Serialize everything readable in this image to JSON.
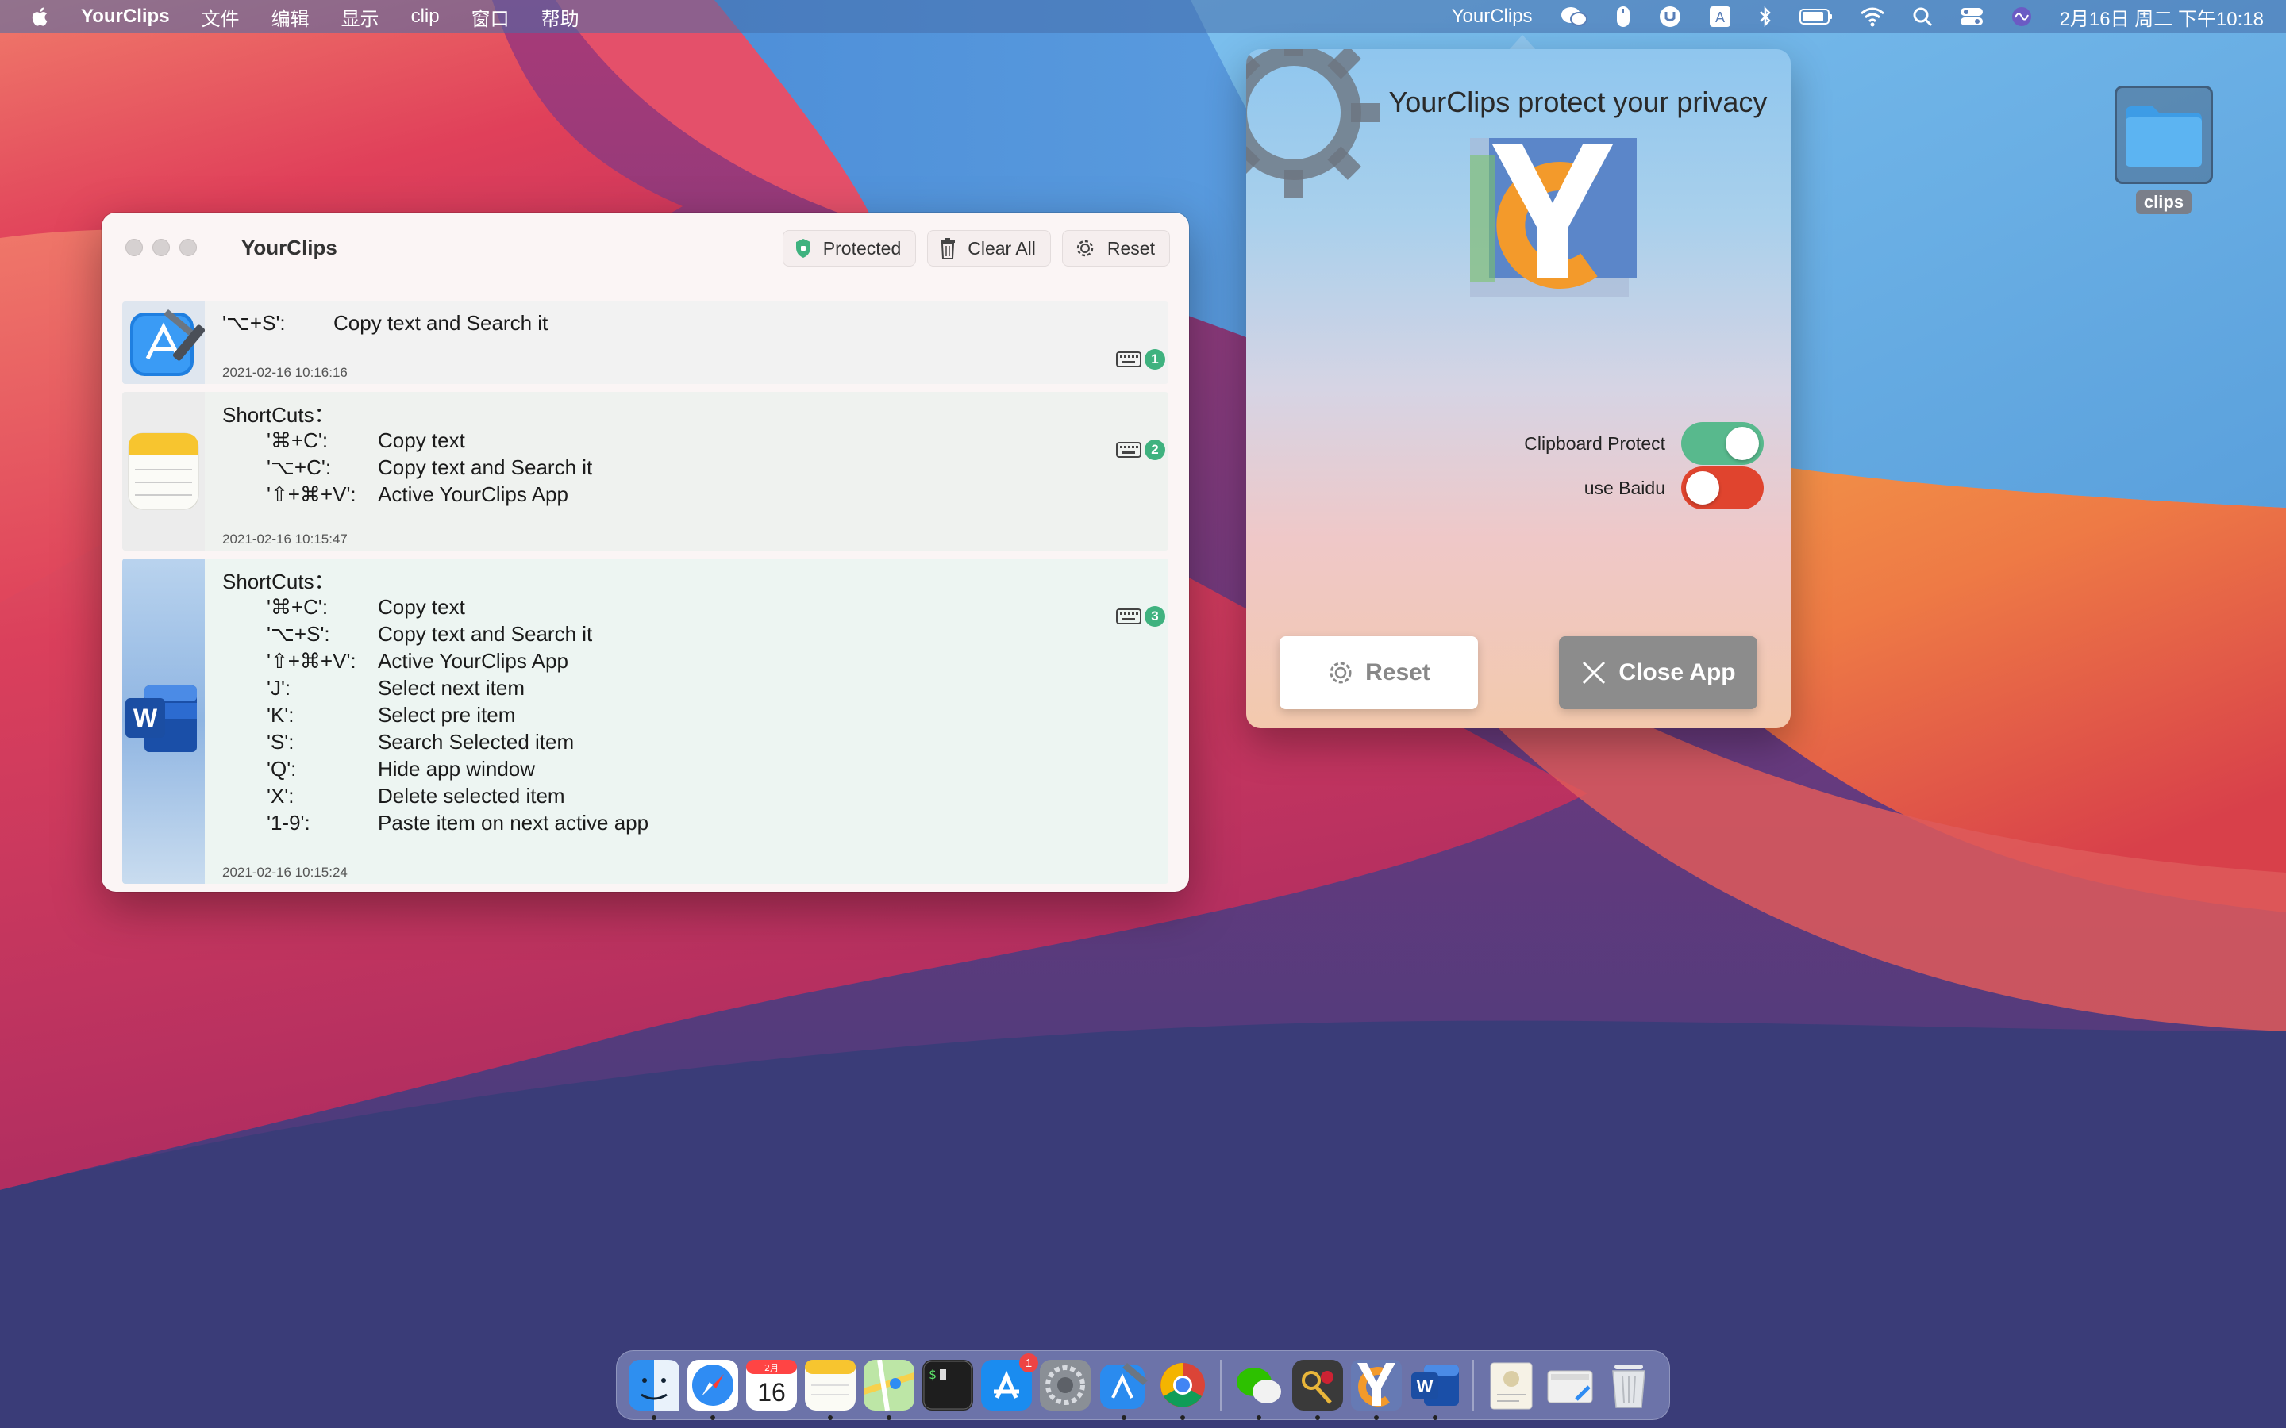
{
  "menubar": {
    "app_name": "YourClips",
    "items": [
      "文件",
      "编辑",
      "显示",
      "clip",
      "窗口",
      "帮助"
    ],
    "status_app": "YourClips",
    "clock": "2月16日 周二 下午10:18"
  },
  "desktop": {
    "folder_label": "clips"
  },
  "window": {
    "title": "YourClips",
    "buttons": {
      "protected": "Protected",
      "clear_all": "Clear All",
      "reset": "Reset"
    },
    "clips": [
      {
        "app_icon": "xcode-icon",
        "lines": [
          {
            "key": "'⌥+S':",
            "desc": "Copy text and Search it"
          }
        ],
        "time": "2021-02-16 10:16:16",
        "index": "1"
      },
      {
        "app_icon": "notes-icon",
        "heading": "ShortCuts：",
        "lines": [
          {
            "key": "'⌘+C':",
            "desc": "Copy text"
          },
          {
            "key": "'⌥+C':",
            "desc": "Copy text and Search it"
          },
          {
            "key": "'⇧+⌘+V':",
            "desc": "Active YourClips App"
          }
        ],
        "time": "2021-02-16 10:15:47",
        "index": "2"
      },
      {
        "app_icon": "word-icon",
        "heading": "ShortCuts：",
        "lines": [
          {
            "key": "'⌘+C':",
            "desc": "Copy text"
          },
          {
            "key": "'⌥+S':",
            "desc": "Copy text and Search it"
          },
          {
            "key": "'⇧+⌘+V':",
            "desc": "Active YourClips App"
          },
          {
            "key": "'J':",
            "desc": "Select next item"
          },
          {
            "key": "'K':",
            "desc": "Select pre item"
          },
          {
            "key": "'S':",
            "desc": "Search Selected item"
          },
          {
            "key": "'Q':",
            "desc": "Hide app window"
          },
          {
            "key": "'X':",
            "desc": "Delete selected item"
          },
          {
            "key": "'1-9':",
            "desc": "Paste item on next active app"
          }
        ],
        "time": "2021-02-16 10:15:24",
        "index": "3"
      }
    ]
  },
  "popover": {
    "title": "YourClips protect your privacy",
    "toggles": {
      "clipboard_protect": {
        "label": "Clipboard Protect",
        "state": "on"
      },
      "use_baidu": {
        "label": "use Baidu",
        "state": "off"
      }
    },
    "reset_label": "Reset",
    "close_label": "Close App"
  },
  "dock": {
    "calendar_month": "2月",
    "calendar_day": "16",
    "appstore_badge": "1",
    "apps": [
      "finder-icon",
      "safari-icon",
      "calendar-icon",
      "notes-icon",
      "maps-icon",
      "terminal-icon",
      "appstore-icon",
      "system-preferences-icon",
      "xcode-icon",
      "chrome-icon",
      "wechat-icon",
      "keychain-icon",
      "yourclips-icon",
      "word-icon",
      "preview-icon",
      "screenshot-icon",
      "trash-icon"
    ]
  },
  "colors": {
    "toggle_on": "#58b98d",
    "toggle_off": "#e0442e",
    "badge": "#3fb27f",
    "logo_orange": "#f39a2b",
    "logo_blue": "#5b86c9"
  }
}
